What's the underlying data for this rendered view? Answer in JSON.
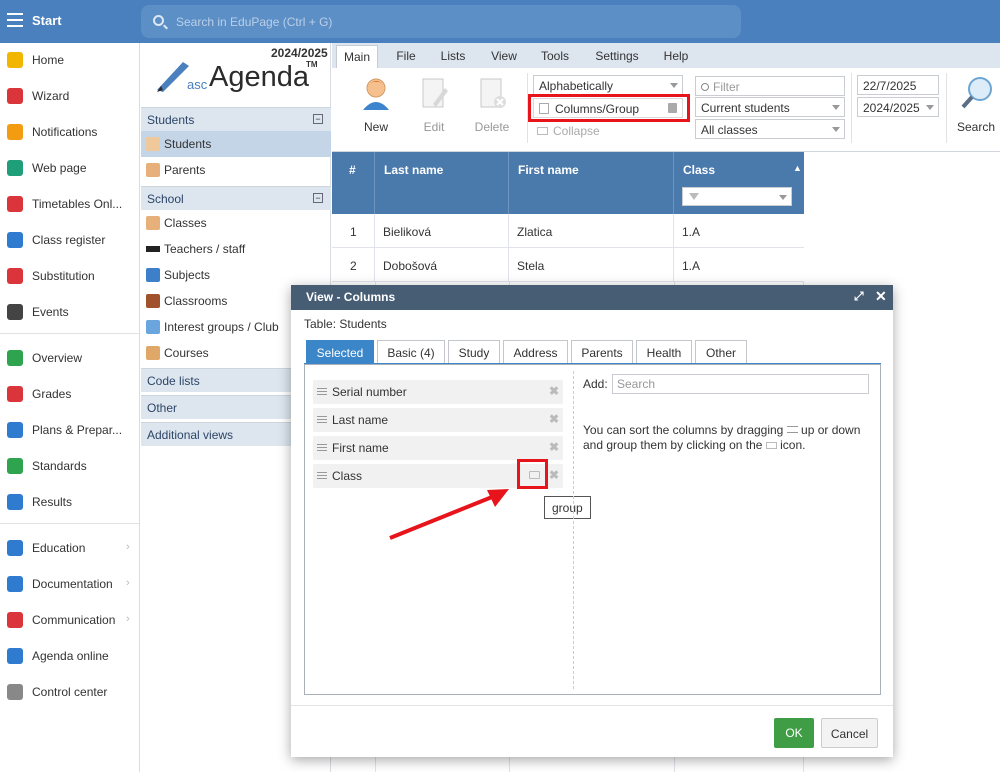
{
  "topbar": {
    "start": "Start",
    "search_placeholder": "Search in EduPage (Ctrl + G)"
  },
  "nav": [
    {
      "label": "Home",
      "icon": "star-icon",
      "color": "#f2b600",
      "chev": false
    },
    {
      "label": "Wizard",
      "icon": "wand-icon",
      "color": "#d9353a",
      "chev": false
    },
    {
      "label": "Notifications",
      "icon": "envelope-icon",
      "color": "#f39c12",
      "chev": false
    },
    {
      "label": "Web page",
      "icon": "house-icon",
      "color": "#1f9e7a",
      "chev": false
    },
    {
      "label": "Timetables Onl...",
      "icon": "timetable-icon",
      "color": "#d9353a",
      "chev": false
    },
    {
      "label": "Class register",
      "icon": "book-icon",
      "color": "#2e7bcf",
      "chev": false
    },
    {
      "label": "Substitution",
      "icon": "person-icon",
      "color": "#d9353a",
      "chev": false
    },
    {
      "label": "Events",
      "icon": "calendar-icon",
      "color": "#444444",
      "chev": false
    },
    {
      "label": "Overview",
      "icon": "check-circle-icon",
      "color": "#2ea44f",
      "chev": false
    },
    {
      "label": "Grades",
      "icon": "grade-circle-icon",
      "color": "#d9353a",
      "chev": false
    },
    {
      "label": "Plans & Prepar...",
      "icon": "briefcase-icon",
      "color": "#2e7bcf",
      "chev": false
    },
    {
      "label": "Standards",
      "icon": "shield-icon",
      "color": "#2ea44f",
      "chev": false
    },
    {
      "label": "Results",
      "icon": "bar-chart-icon",
      "color": "#2e7bcf",
      "chev": false
    },
    {
      "label": "Education",
      "icon": "education-icon",
      "color": "#2e7bcf",
      "chev": true
    },
    {
      "label": "Documentation",
      "icon": "document-icon",
      "color": "#2e7bcf",
      "chev": true
    },
    {
      "label": "Communication",
      "icon": "chat-icon",
      "color": "#d9353a",
      "chev": true
    },
    {
      "label": "Agenda online",
      "icon": "pen-icon",
      "color": "#2e7bcf",
      "chev": false
    },
    {
      "label": "Control center",
      "icon": "gear-icon",
      "color": "#888888",
      "chev": false
    }
  ],
  "sub": {
    "year": "2024/2025",
    "logo_asc": "asc",
    "logo_agenda": "Agenda",
    "logo_tm": "TM",
    "students_header": "Students",
    "students_items": [
      "Students",
      "Parents"
    ],
    "school_header": "School",
    "school_items": [
      "Classes",
      "Teachers / staff",
      "Subjects",
      "Classrooms",
      "Interest groups / Club",
      "Courses"
    ],
    "code_lists": "Code lists",
    "other": "Other",
    "additional_views": "Additional views"
  },
  "tabs": [
    "Main",
    "File",
    "Lists",
    "View",
    "Tools",
    "Settings",
    "Help"
  ],
  "toolbar": {
    "new": "New",
    "edit": "Edit",
    "delete": "Delete",
    "sort": "Alphabetically",
    "columns_group": "Columns/Group",
    "collapse": "Collapse",
    "filter_placeholder": "Filter",
    "students_filter": "Current students",
    "classes_filter": "All classes",
    "date": "22/7/2025",
    "year": "2024/2025",
    "search": "Search"
  },
  "grid": {
    "headers": [
      "#",
      "Last name",
      "First name",
      "Class"
    ],
    "rows": [
      [
        "1",
        "Bieliková",
        "Zlatica",
        "1.A"
      ],
      [
        "2",
        "Dobošová",
        "Stela",
        "1.A"
      ]
    ]
  },
  "dialog": {
    "title": "View - Columns",
    "table_label": "Table: Students",
    "tabs": [
      "Selected",
      "Basic (4)",
      "Study",
      "Address",
      "Parents",
      "Health",
      "Other"
    ],
    "columns": [
      "Serial number",
      "Last name",
      "First name",
      "Class"
    ],
    "add_label": "Add:",
    "search_placeholder": "Search",
    "hint1": "You can sort the columns by dragging ",
    "hint1b": " up or down",
    "hint2": "and group them by clicking on the ",
    "hint2b": " icon.",
    "tooltip": "group",
    "ok": "OK",
    "cancel": "Cancel"
  },
  "colors": {
    "topbar": "#4a80bd",
    "highlight": "#e8141c",
    "ok": "#3f9e45"
  }
}
